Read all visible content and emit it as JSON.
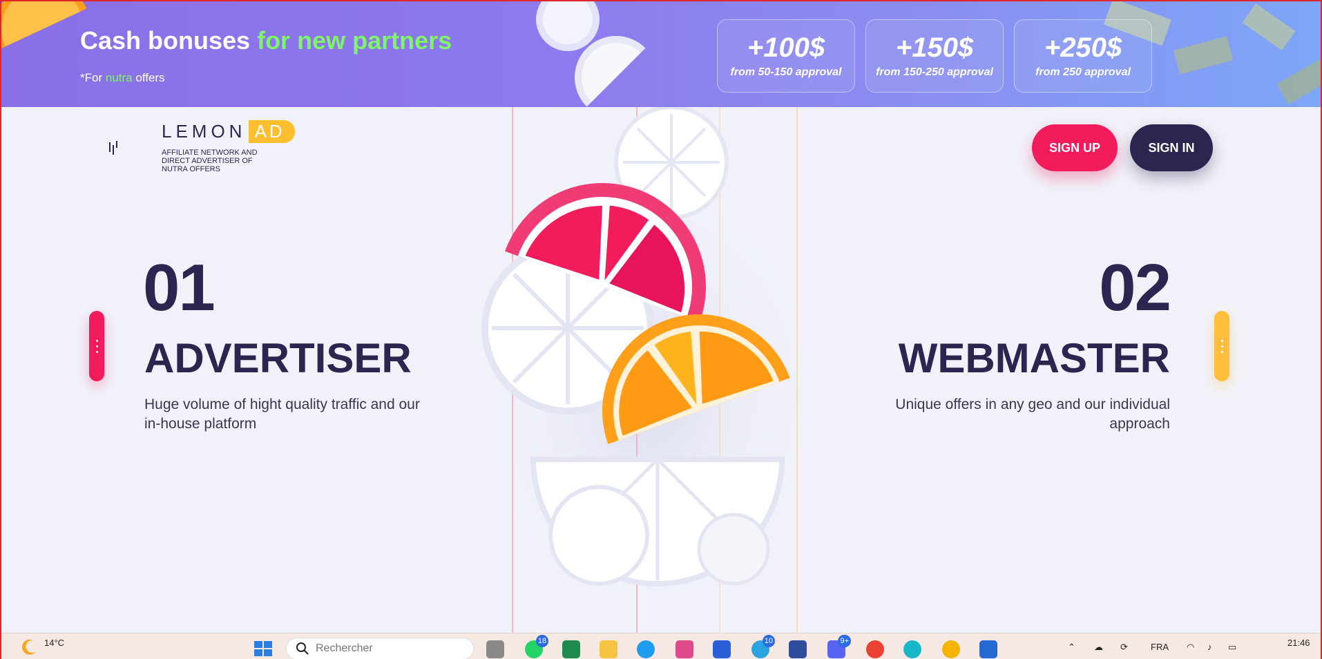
{
  "banner": {
    "title_main": "Cash bonuses",
    "title_accent": "for new partners",
    "sub_prefix": "*For",
    "sub_accent": "nutra",
    "sub_suffix": "offers",
    "bonuses": [
      {
        "amount": "+100$",
        "condition": "from 50-150 approval"
      },
      {
        "amount": "+150$",
        "condition": "from 150-250 approval"
      },
      {
        "amount": "+250$",
        "condition": "from 250 approval"
      }
    ]
  },
  "header": {
    "logo_lemon": "LEMON",
    "logo_ad": "AD",
    "tagline": "AFFILIATE NETWORK AND DIRECT ADVERTISER OF NUTRA OFFERS",
    "signup_label": "SIGN UP",
    "signin_label": "SIGN IN"
  },
  "sections": {
    "advertiser": {
      "number": "01",
      "title": "ADVERTISER",
      "description": "Huge volume of hight quality traffic and our in-house platform"
    },
    "webmaster": {
      "number": "02",
      "title": "WEBMASTER",
      "description": "Unique offers in any geo and our individual approach"
    }
  },
  "taskbar": {
    "temperature": "14°C",
    "search_placeholder": "Rechercher",
    "badge_whatsapp": "18",
    "badge_telegram": "10",
    "badge_discord": "9+",
    "language": "FRA",
    "time": "21:46"
  },
  "colors": {
    "accent_pink": "#f21c5c",
    "accent_yellow": "#ffbe2e",
    "dark_navy": "#2d2550",
    "accent_green": "#7ef46a"
  }
}
